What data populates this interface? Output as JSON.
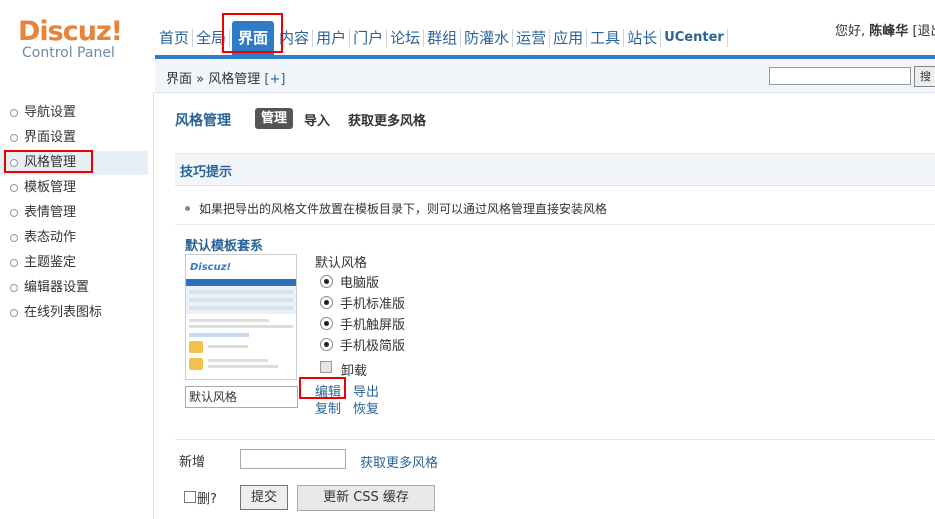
{
  "header": {
    "logo_main": "Discuz!",
    "logo_sub": "Control Panel",
    "nav": [
      "首页",
      "全局",
      "界面",
      "内容",
      "用户",
      "门户",
      "论坛",
      "群组",
      "防灌水",
      "运营",
      "应用",
      "工具",
      "站长",
      "UCenter"
    ],
    "active_nav": "界面",
    "greeting": "您好,",
    "username": "陈峰华",
    "logout_text": "[退出"
  },
  "breadcrumb": {
    "section": "界面",
    "separator": "»",
    "page": "风格管理",
    "add": "[+]"
  },
  "search": {
    "button": "搜"
  },
  "sidebar": {
    "items": [
      {
        "label": "导航设置"
      },
      {
        "label": "界面设置"
      },
      {
        "label": "风格管理"
      },
      {
        "label": "模板管理"
      },
      {
        "label": "表情管理"
      },
      {
        "label": "表态动作"
      },
      {
        "label": "主题鉴定"
      },
      {
        "label": "编辑器设置"
      },
      {
        "label": "在线列表图标"
      }
    ],
    "active_index": 2
  },
  "main": {
    "title": "风格管理",
    "tabs": [
      "管理",
      "导入",
      "获取更多风格"
    ],
    "active_tab": "管理",
    "tips": {
      "title": "技巧提示",
      "text": "如果把导出的风格文件放置在模板目录下，则可以通过风格管理直接安装风格"
    },
    "template_set": {
      "name": "默认模板套系",
      "style_name_value": "默认风格",
      "preview_logo": "Discuz!",
      "default_label": "默认风格",
      "radios": [
        "电脑版",
        "手机标准版",
        "手机触屏版",
        "手机极简版"
      ],
      "uninstall": "卸载",
      "actions": {
        "edit": "编辑",
        "export": "导出",
        "copy": "复制",
        "restore": "恢复"
      }
    },
    "new_row": {
      "label": "新增",
      "more_link": "获取更多风格"
    },
    "footer": {
      "delete_label": "删?",
      "submit": "提交",
      "update_css": "更新 CSS 缓存"
    }
  },
  "colors": {
    "accent": "#2f7cc4",
    "logo_orange": "#e8833a",
    "link": "#2a6496",
    "highlight": "#ee0000"
  }
}
